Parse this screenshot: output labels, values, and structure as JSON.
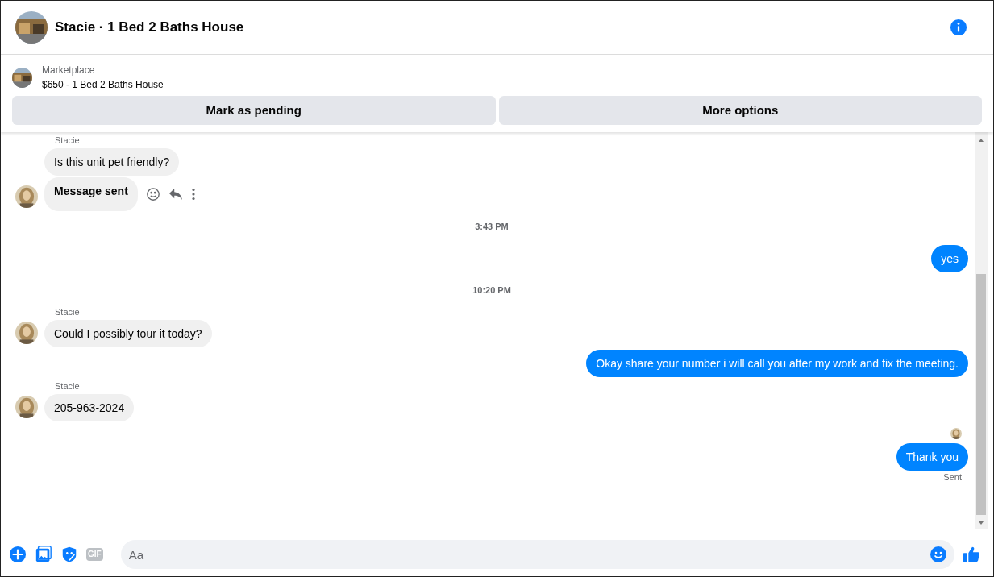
{
  "header": {
    "title": "Stacie · 1 Bed 2 Baths House"
  },
  "listing": {
    "source": "Marketplace",
    "title": "$650 - 1 Bed 2 Baths House",
    "buttons": [
      "Mark as pending",
      "More options"
    ]
  },
  "thread": [
    {
      "kind": "incoming",
      "sender": "Stacie",
      "messages": [
        {
          "text": "Is this unit pet friendly?",
          "emphasized": false,
          "hovered": false
        },
        {
          "text": "Message sent",
          "emphasized": true,
          "hovered": true
        }
      ]
    },
    {
      "kind": "time",
      "text": "3:43 PM"
    },
    {
      "kind": "outgoing",
      "messages": [
        {
          "text": "yes"
        }
      ]
    },
    {
      "kind": "time",
      "text": "10:20 PM"
    },
    {
      "kind": "incoming",
      "sender": "Stacie",
      "messages": [
        {
          "text": "Could I possibly tour it today?",
          "emphasized": false,
          "hovered": false
        }
      ]
    },
    {
      "kind": "outgoing",
      "messages": [
        {
          "text": "Okay share your number i will call you after my work and fix the meeting."
        }
      ]
    },
    {
      "kind": "incoming",
      "sender": "Stacie",
      "messages": [
        {
          "text": "205-963-2024",
          "emphasized": false,
          "hovered": false
        }
      ]
    },
    {
      "kind": "seen"
    },
    {
      "kind": "outgoing",
      "messages": [
        {
          "text": "Thank you"
        }
      ],
      "status": "Sent"
    }
  ],
  "composer": {
    "placeholder": "Aa",
    "gif_label": "GIF"
  }
}
